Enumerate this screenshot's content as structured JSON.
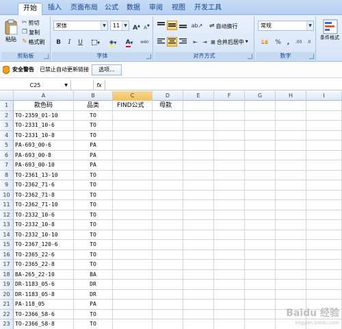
{
  "tabs": [
    "开始",
    "插入",
    "页面布局",
    "公式",
    "数据",
    "审阅",
    "视图",
    "开发工具"
  ],
  "clipboard": {
    "paste": "粘贴",
    "cut": "剪切",
    "copy": "复制",
    "format_painter": "格式刷",
    "label": "剪贴板"
  },
  "font": {
    "name": "宋体",
    "size": "11",
    "label": "字体",
    "bold": "B",
    "italic": "I",
    "underline": "U",
    "grow": "A",
    "shrink": "A",
    "font_color": "A",
    "phonetic": "wén"
  },
  "alignment": {
    "wrap": "自动换行",
    "merge": "合并后居中",
    "label": "对齐方式"
  },
  "number": {
    "format": "常规",
    "percent": "%",
    "comma": ",",
    "inc_decimal": ".00",
    "dec_decimal": ".0",
    "label": "数字"
  },
  "styles": {
    "cond_format": "条件格式"
  },
  "security": {
    "title": "安全警告",
    "message": "已禁止自动更新链接",
    "options": "选项..."
  },
  "formula_bar": {
    "name_box": "C25",
    "fx": "fx",
    "value": ""
  },
  "columns": [
    "A",
    "B",
    "C",
    "D",
    "E",
    "F",
    "G",
    "H",
    "I"
  ],
  "header_row": [
    "款色码",
    "品类",
    "FIND公式",
    "母款"
  ],
  "rows": [
    {
      "num": "1"
    },
    {
      "num": "2",
      "a": "TO-2359_01-10",
      "b": "TO"
    },
    {
      "num": "3",
      "a": "TO-2331_10-6",
      "b": "TO"
    },
    {
      "num": "4",
      "a": "TO-2331_10-8",
      "b": "TO"
    },
    {
      "num": "5",
      "a": "PA-693_00-6",
      "b": "PA"
    },
    {
      "num": "6",
      "a": "PA-693_00-8",
      "b": "PA"
    },
    {
      "num": "7",
      "a": "PA-693_00-10",
      "b": "PA"
    },
    {
      "num": "8",
      "a": "TO-2361_13-10",
      "b": "TO"
    },
    {
      "num": "9",
      "a": "TO-2362_71-6",
      "b": "TO"
    },
    {
      "num": "10",
      "a": "TO-2362_71-8",
      "b": "TO"
    },
    {
      "num": "11",
      "a": "TO-2362_71-10",
      "b": "TO"
    },
    {
      "num": "12",
      "a": "TO-2332_10-6",
      "b": "TO"
    },
    {
      "num": "13",
      "a": "TO-2332_10-8",
      "b": "TO"
    },
    {
      "num": "14",
      "a": "TO-2332_10-10",
      "b": "TO"
    },
    {
      "num": "15",
      "a": "TO-2367_120-6",
      "b": "TO"
    },
    {
      "num": "16",
      "a": "TO-2365_22-6",
      "b": "TO"
    },
    {
      "num": "17",
      "a": "TO-2365_22-8",
      "b": "TO"
    },
    {
      "num": "18",
      "a": "BA-265_22-10",
      "b": "BA"
    },
    {
      "num": "19",
      "a": "DR-1183_05-6",
      "b": "DR"
    },
    {
      "num": "20",
      "a": "DR-1183_05-8",
      "b": "DR"
    },
    {
      "num": "21",
      "a": "PA-118_05",
      "b": "PA"
    },
    {
      "num": "22",
      "a": "TO-2366_58-6",
      "b": "TO"
    },
    {
      "num": "23",
      "a": "TO-2366_58-8",
      "b": "TO"
    }
  ],
  "watermark": {
    "brand": "Baidu 经验",
    "url": "jingyan.baidu.com"
  },
  "colors": {
    "ribbon": "#d4e3f7",
    "tab_text": "#15428b",
    "selected_col": "#f1c15d"
  }
}
